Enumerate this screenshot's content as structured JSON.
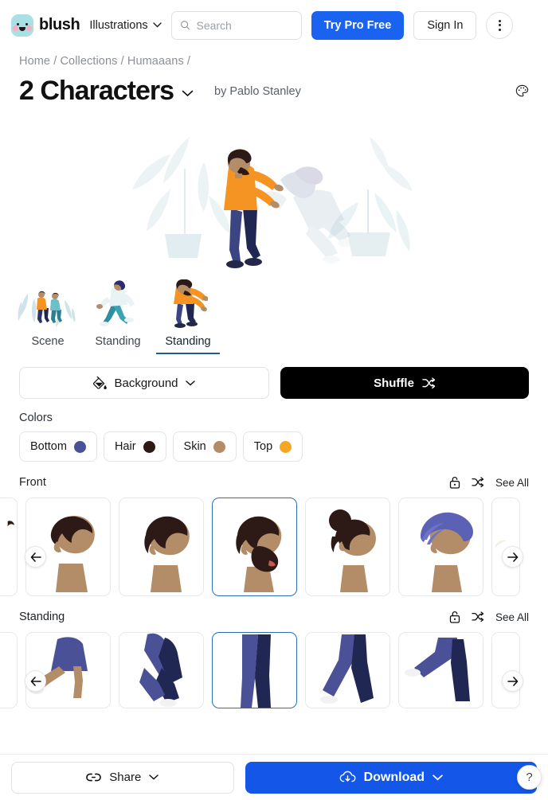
{
  "topnav": {
    "logo_text": "blush",
    "nav_dropdown": "Illustrations",
    "search_placeholder": "Search",
    "search_value": "",
    "try_pro_label": "Try Pro Free",
    "sign_in_label": "Sign In",
    "accent_blue": "#1a63f0"
  },
  "breadcrumb": {
    "items": [
      "Home",
      "Collections",
      "Humaaans"
    ],
    "separator": "/",
    "full_text": "Home / Collections / Humaaans /"
  },
  "title": {
    "heading": "2 Characters",
    "chevron": "⌄",
    "author": "by Pablo Stanley"
  },
  "canvas": {
    "selected_character_index": 0,
    "close_label": "✕"
  },
  "part_tabs": [
    {
      "label": "Scene",
      "active": false
    },
    {
      "label": "Standing",
      "active": false
    },
    {
      "label": "Standing",
      "active": true
    }
  ],
  "actions": {
    "background_label": "Background",
    "background_chevron": "⌄",
    "shuffle_label": "Shuffle"
  },
  "colors": {
    "title": "Colors",
    "chips": [
      {
        "label": "Bottom",
        "hex": "#4b5197"
      },
      {
        "label": "Hair",
        "hex": "#2d1a16"
      },
      {
        "label": "Skin",
        "hex": "#b28d68"
      },
      {
        "label": "Top",
        "hex": "#f5a623"
      }
    ]
  },
  "sections": [
    {
      "name": "Front",
      "see_all": "See All",
      "lock_icon": "lock-open-icon",
      "shuffle_icon": "shuffle-icon",
      "prev_label": "←",
      "next_label": "→",
      "selected_index": 2,
      "options": [
        {
          "id": "front-hair-1",
          "kind": "partial-left"
        },
        {
          "id": "front-hair-2",
          "kind": "head-short-hair"
        },
        {
          "id": "front-hair-3",
          "kind": "head-bowl-hair"
        },
        {
          "id": "front-hair-4",
          "kind": "head-beard"
        },
        {
          "id": "front-hair-5",
          "kind": "head-bun"
        },
        {
          "id": "front-hair-6",
          "kind": "head-turban"
        },
        {
          "id": "front-hair-7",
          "kind": "partial-right"
        }
      ]
    },
    {
      "name": "Standing",
      "see_all": "See All",
      "lock_icon": "lock-open-icon",
      "shuffle_icon": "shuffle-icon",
      "prev_label": "←",
      "next_label": "→",
      "selected_index": 2,
      "options": [
        {
          "id": "legs-1",
          "kind": "partial-left"
        },
        {
          "id": "legs-2",
          "kind": "legs-skirt"
        },
        {
          "id": "legs-3",
          "kind": "legs-bent"
        },
        {
          "id": "legs-4",
          "kind": "legs-straight"
        },
        {
          "id": "legs-5",
          "kind": "legs-stride"
        },
        {
          "id": "legs-6",
          "kind": "legs-kick"
        },
        {
          "id": "legs-7",
          "kind": "partial-right"
        }
      ]
    }
  ],
  "bottombar": {
    "share_label": "Share",
    "share_chevron": "⌄",
    "download_label": "Download",
    "download_chevron": "⌄",
    "help_label": "?"
  }
}
